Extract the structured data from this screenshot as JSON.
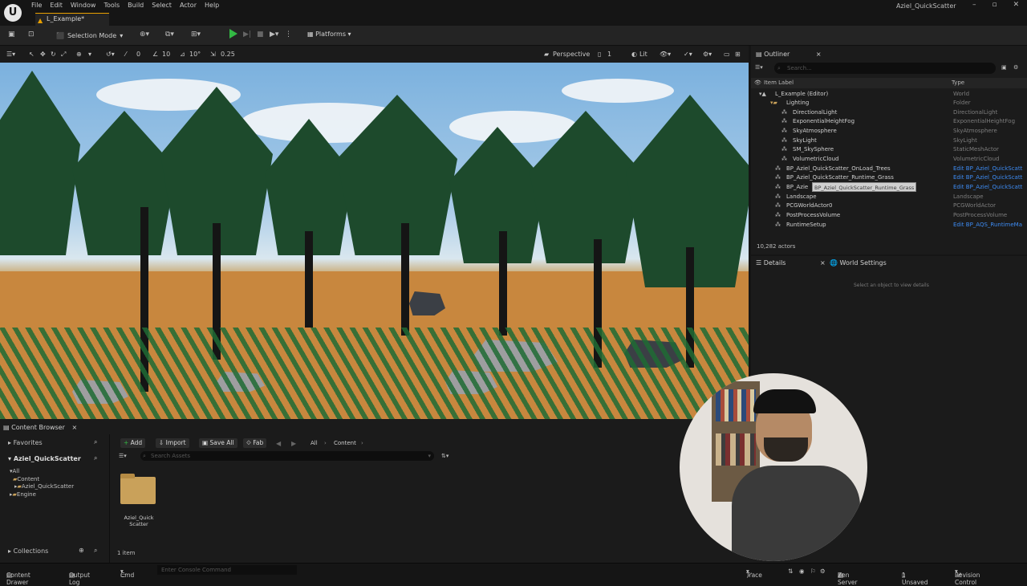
{
  "app": {
    "logo": "U",
    "project_name": "Aziel_QuickScatter",
    "level_tab": "L_Example*",
    "menu": [
      "File",
      "Edit",
      "Window",
      "Tools",
      "Build",
      "Select",
      "Actor",
      "Help"
    ]
  },
  "toolbar": {
    "mode": "Selection Mode",
    "platforms": "Platforms"
  },
  "viewport_toolbar": {
    "translate_snap": "0",
    "rotate_snap": "10",
    "angle": "10°",
    "scale_snap": "0.25",
    "view_type": "Perspective",
    "view_count": "1",
    "lighting": "Lit"
  },
  "outliner": {
    "title": "Outliner",
    "search_placeholder": "Search...",
    "col_label": "Item Label",
    "col_type": "Type",
    "rows": [
      {
        "label": "L_Example (Editor)",
        "type": "World",
        "indent": 0
      },
      {
        "label": "Lighting",
        "type": "Folder",
        "indent": 1
      },
      {
        "label": "DirectionalLight",
        "type": "DirectionalLight",
        "indent": 2
      },
      {
        "label": "ExponentialHeightFog",
        "type": "ExponentialHeightFog",
        "indent": 2
      },
      {
        "label": "SkyAtmosphere",
        "type": "SkyAtmosphere",
        "indent": 2
      },
      {
        "label": "SkyLight",
        "type": "SkyLight",
        "indent": 2
      },
      {
        "label": "SM_SkySphere",
        "type": "StaticMeshActor",
        "indent": 2
      },
      {
        "label": "VolumetricCloud",
        "type": "VolumetricCloud",
        "indent": 2
      },
      {
        "label": "BP_Aziel_QuickScatter_OnLoad_Trees",
        "type": "Edit BP_Aziel_QuickScatt",
        "indent": 1,
        "link": true
      },
      {
        "label": "BP_Aziel_QuickScatter_Runtime_Grass",
        "type": "Edit BP_Aziel_QuickScatt",
        "indent": 1,
        "link": true
      },
      {
        "label": "BP_Azie",
        "type": "Edit BP_Aziel_QuickScatt",
        "indent": 1,
        "link": true
      },
      {
        "label": "Landscape",
        "type": "Landscape",
        "indent": 1
      },
      {
        "label": "PCGWorldActor0",
        "type": "PCGWorldActor",
        "indent": 1
      },
      {
        "label": "PostProcessVolume",
        "type": "PostProcessVolume",
        "indent": 1
      },
      {
        "label": "RuntimeSetup",
        "type": "Edit BP_AQS_RuntimeMa",
        "indent": 1,
        "link": true
      }
    ],
    "tooltip": "BP_Aziel_QuickScatter_Runtime_Grass",
    "actor_count": "10,282 actors"
  },
  "details": {
    "tab_details": "Details",
    "tab_world": "World Settings",
    "empty_message": "Select an object to view details"
  },
  "content_browser": {
    "title": "Content Browser",
    "favorites": "Favorites",
    "project": "Aziel_QuickScatter",
    "tree": [
      "All",
      "Content",
      "Aziel_QuickScatter",
      "Engine"
    ],
    "collections": "Collections",
    "add": "Add",
    "import": "Import",
    "save_all": "Save All",
    "fab": "Fab",
    "path": [
      "All",
      "Content"
    ],
    "search_placeholder": "Search Assets",
    "asset_name": "Aziel_Quick\nScatter",
    "item_count": "1 item"
  },
  "statusbar": {
    "content_drawer": "Content Drawer",
    "output_log": "Output Log",
    "cmd": "Cmd",
    "console_placeholder": "Enter Console Command",
    "trace": "Trace",
    "zen": "Zen Server",
    "unsaved": "1 Unsaved",
    "revision": "Revision Control"
  },
  "colors": {
    "accent": "#e8a000",
    "play_green": "#33b944",
    "link_blue": "#3d8bf2"
  }
}
